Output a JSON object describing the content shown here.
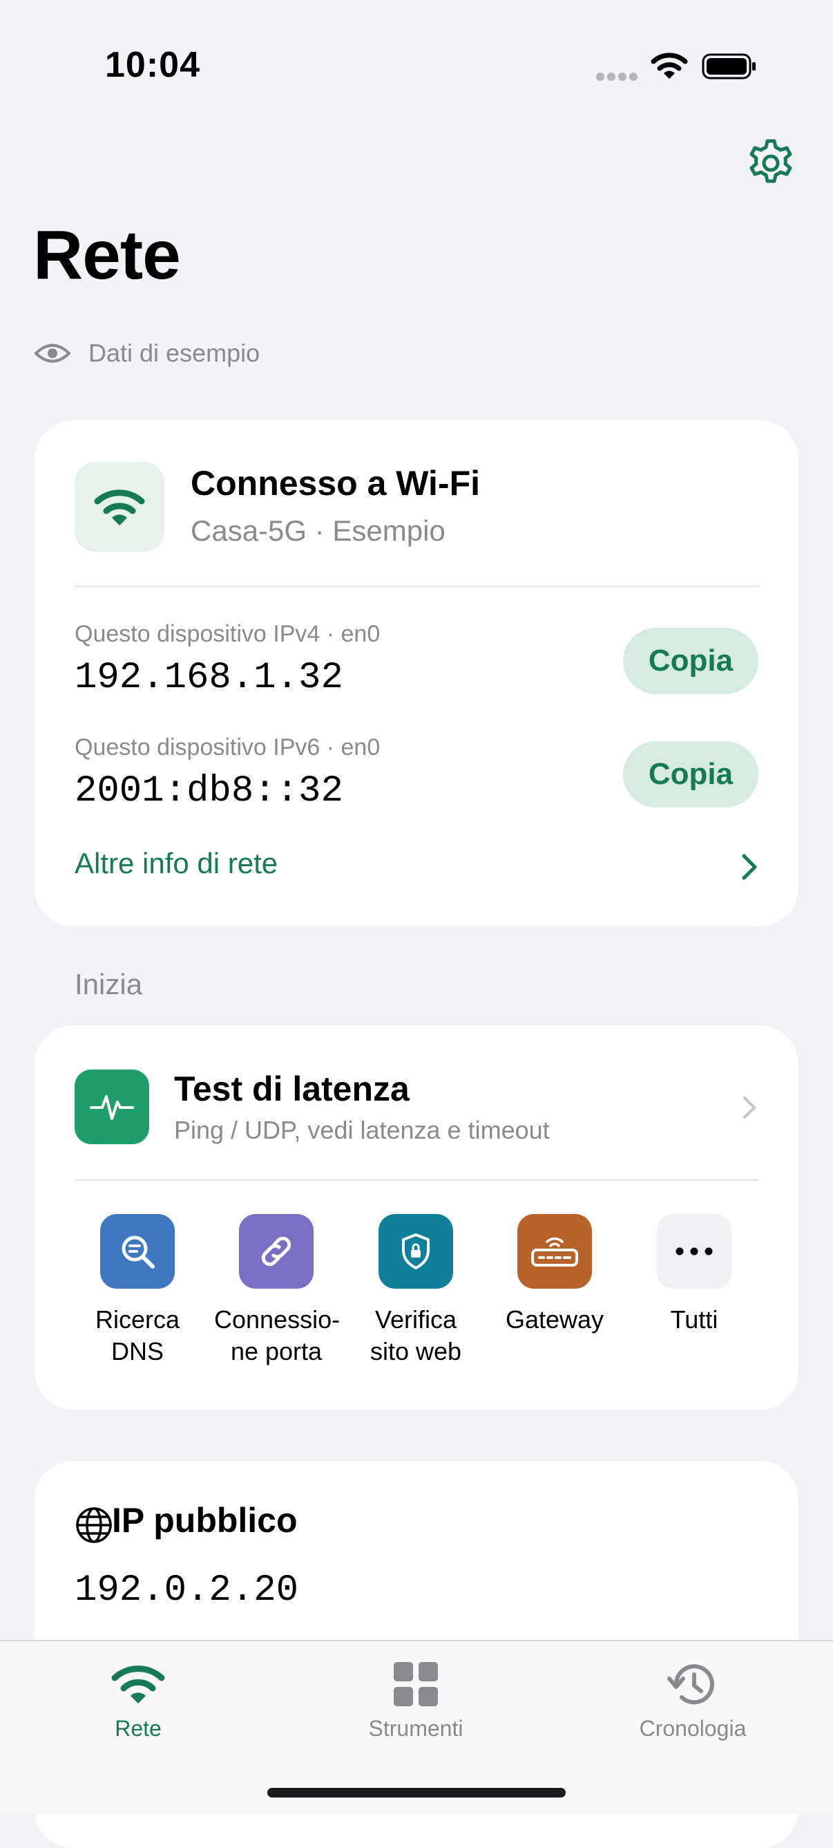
{
  "status_bar": {
    "time": "10:04"
  },
  "header": {
    "title": "Rete",
    "sample_label": "Dati di esempio"
  },
  "connection": {
    "title": "Connesso a Wi-Fi",
    "subtitle": "Casa-5G · Esempio",
    "ipv4": {
      "label": "Questo dispositivo IPv4 · en0",
      "value": "192.168.1.32",
      "button": "Copia"
    },
    "ipv6": {
      "label": "Questo dispositivo IPv6 · en0",
      "value": "2001:db8::32",
      "button": "Copia"
    },
    "more_info": "Altre info di rete"
  },
  "start": {
    "section_label": "Inizia",
    "latency": {
      "title": "Test di latenza",
      "subtitle": "Ping / UDP, vedi latenza e timeout"
    },
    "tools": [
      {
        "line1": "Ricerca",
        "line2": "DNS",
        "icon": "magnifier-icon",
        "color": "#3f78c0"
      },
      {
        "line1": "Connessio-",
        "line2": "ne porta",
        "icon": "link-icon",
        "color": "#7b6fc4"
      },
      {
        "line1": "Verifica",
        "line2": "sito web",
        "icon": "shield-lock-icon",
        "color": "#0f7f9a"
      },
      {
        "line1": "Gateway",
        "line2": "",
        "icon": "router-icon",
        "color": "#b8632c"
      },
      {
        "line1": "Tutti",
        "line2": "",
        "icon": "ellipsis-icon",
        "color": "#f0f0f4"
      }
    ]
  },
  "public_ip": {
    "title": "IP pubblico",
    "value": "192.0.2.20"
  },
  "tabbar": {
    "tabs": [
      {
        "label": "Rete",
        "active": true,
        "color": "#157a55"
      },
      {
        "label": "Strumenti",
        "active": false,
        "color": "#8a8a8e"
      },
      {
        "label": "Cronologia",
        "active": false,
        "color": "#8a8a8e"
      }
    ]
  },
  "colors": {
    "accent": "#157a55",
    "background": "#f2f2f7"
  }
}
